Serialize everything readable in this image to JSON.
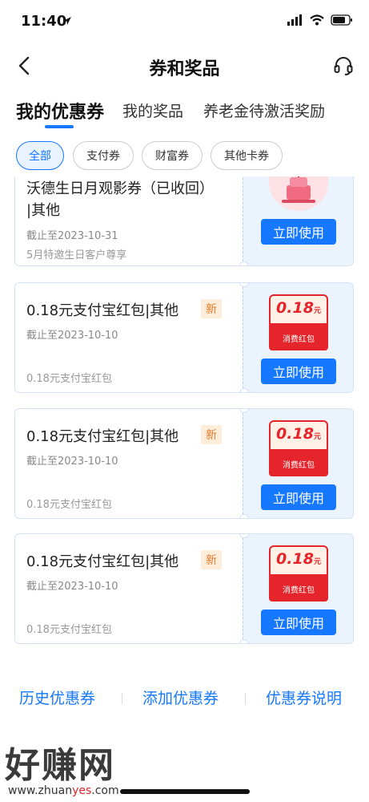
{
  "status": {
    "time": "11:40"
  },
  "nav": {
    "title": "券和奖品"
  },
  "tabs": [
    {
      "label": "我的优惠券",
      "active": true
    },
    {
      "label": "我的奖品",
      "active": false
    },
    {
      "label": "养老金待激活奖励",
      "active": false
    }
  ],
  "filters": [
    {
      "label": "全部",
      "active": true
    },
    {
      "label": "支付券",
      "active": false
    },
    {
      "label": "财富券",
      "active": false
    },
    {
      "label": "其他卡券",
      "active": false
    }
  ],
  "coupons": [
    {
      "title_line1": "沃德生日月观影券（已收回）",
      "title_line2": "|其他",
      "date": "截止至2023-10-31",
      "desc": "5月特邀生日客户尊享",
      "button": "立即使用",
      "image": "birthday-cake"
    },
    {
      "title": "0.18元支付宝红包|其他",
      "badge": "新",
      "date": "截止至2023-10-10",
      "desc": "0.18元支付宝红包",
      "button": "立即使用",
      "amount": "0.18",
      "amount_unit": "元",
      "packet_label": "消费红包"
    },
    {
      "title": "0.18元支付宝红包|其他",
      "badge": "新",
      "date": "截止至2023-10-10",
      "desc": "0.18元支付宝红包",
      "button": "立即使用",
      "amount": "0.18",
      "amount_unit": "元",
      "packet_label": "消费红包"
    },
    {
      "title": "0.18元支付宝红包|其他",
      "badge": "新",
      "date": "截止至2023-10-10",
      "desc": "0.18元支付宝红包",
      "button": "立即使用",
      "amount": "0.18",
      "amount_unit": "元",
      "packet_label": "消费红包"
    }
  ],
  "bottom_links": [
    "历史优惠券",
    "添加优惠券",
    "优惠券说明"
  ],
  "watermark": {
    "main": "好赚网",
    "url_a": "www.zhuan",
    "url_b": "yes",
    "url_c": ".com"
  },
  "colors": {
    "accent": "#1677ff",
    "red": "#e6242b",
    "badge": "#e07a2b"
  }
}
